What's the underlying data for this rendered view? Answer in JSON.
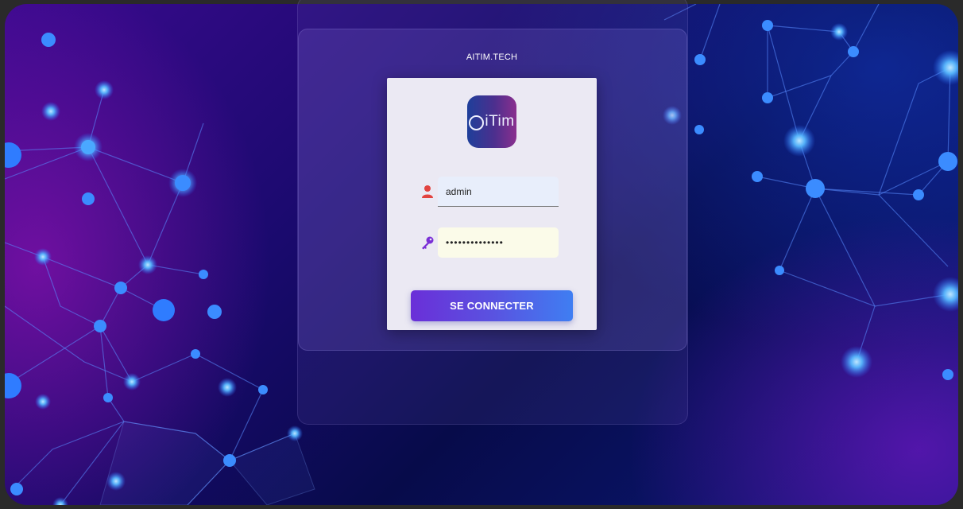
{
  "site": {
    "title": "AITIM.TECH"
  },
  "logo": {
    "text": "iTim"
  },
  "login": {
    "username_value": "admin",
    "password_value": "••••••••••••••",
    "submit_label": "SE CONNECTER"
  },
  "icons": {
    "user": "user-icon",
    "password": "key-icon"
  },
  "colors": {
    "user_icon": "#e2433f",
    "key_icon": "#7a2fd6",
    "button_start": "#6a2fd8",
    "button_end": "#3f7ef2"
  }
}
